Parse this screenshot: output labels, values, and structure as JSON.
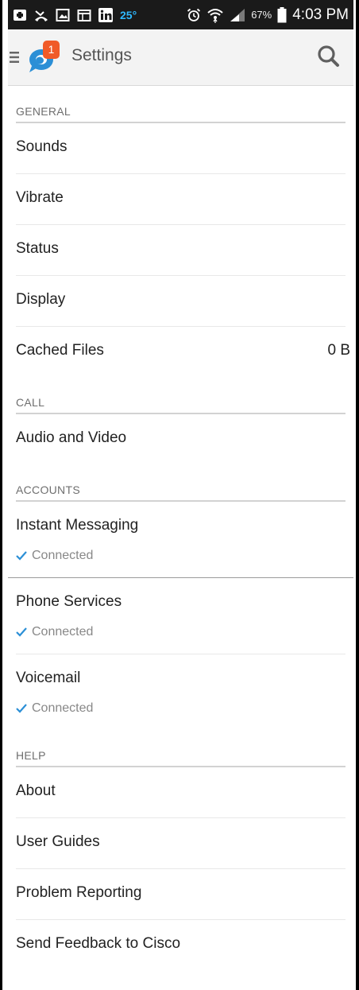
{
  "status_bar": {
    "temperature": "25°",
    "battery_percent": "67%",
    "time": "4:03 PM"
  },
  "app_bar": {
    "title": "Settings",
    "notification_count": "1"
  },
  "sections": {
    "general": {
      "header": "GENERAL",
      "sounds": "Sounds",
      "vibrate": "Vibrate",
      "status": "Status",
      "display": "Display",
      "cached_files": "Cached Files",
      "cached_files_value": "0 B"
    },
    "call": {
      "header": "CALL",
      "audio_video": "Audio and Video"
    },
    "accounts": {
      "header": "ACCOUNTS",
      "instant_messaging": "Instant Messaging",
      "instant_messaging_status": "Connected",
      "phone_services": "Phone Services",
      "phone_services_status": "Connected",
      "voicemail": "Voicemail",
      "voicemail_status": "Connected"
    },
    "help": {
      "header": "HELP",
      "about": "About",
      "user_guides": "User Guides",
      "problem_reporting": "Problem Reporting",
      "send_feedback": "Send Feedback to Cisco"
    }
  },
  "colors": {
    "accent": "#2b8fd6",
    "status_bar_bg": "#1a1a1a",
    "badge": "#f05a28"
  },
  "icons": [
    "notification-icon",
    "missed-call-icon",
    "gallery-icon",
    "calendar-icon",
    "linkedin-icon",
    "alarm-icon",
    "wifi-icon",
    "signal-icon",
    "battery-icon",
    "menu-icon",
    "search-icon",
    "check-icon"
  ]
}
